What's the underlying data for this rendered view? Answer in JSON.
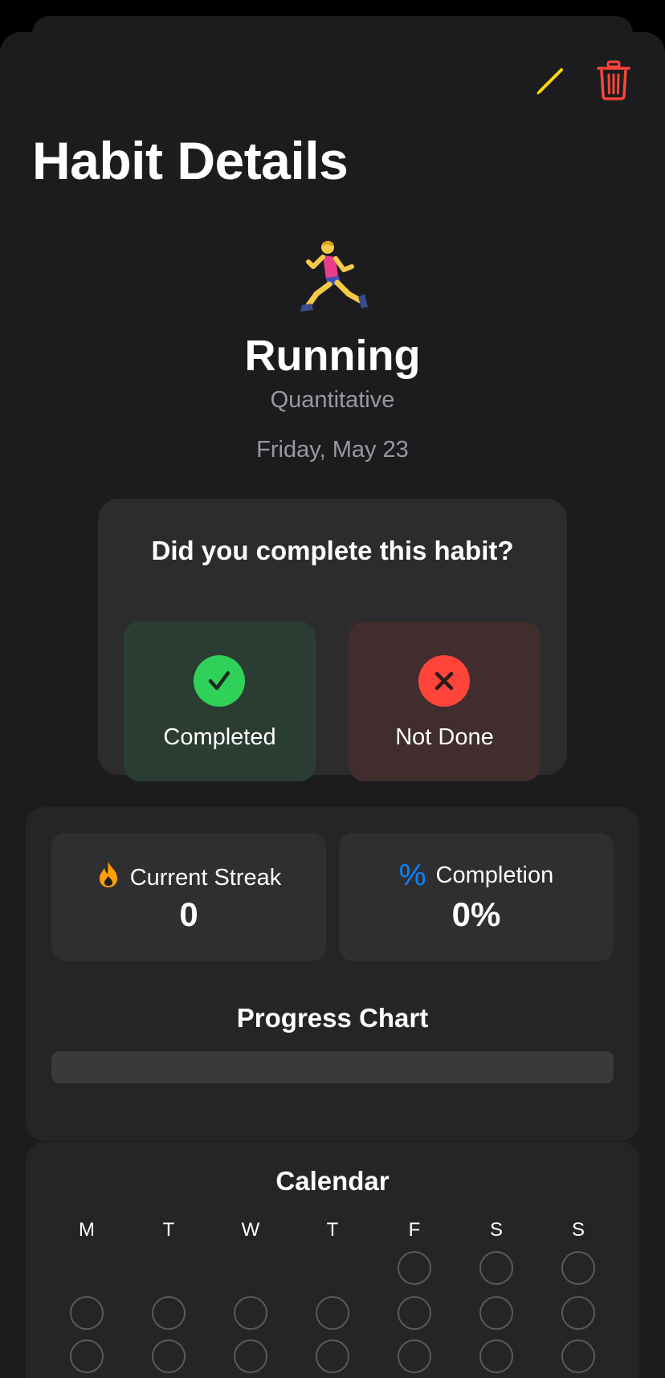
{
  "header": {
    "title": "Habit Details",
    "edit_icon": "pencil-icon",
    "delete_icon": "trash-icon",
    "edit_color": "#ffd60a",
    "delete_color": "#ff453a"
  },
  "habit": {
    "emoji": "running-person-emoji",
    "name": "Running",
    "type": "Quantitative",
    "date": "Friday, May 23"
  },
  "question": {
    "text": "Did you complete this habit?",
    "completed_label": "Completed",
    "not_done_label": "Not Done",
    "completed_color": "#30d158",
    "not_done_color": "#ff453a"
  },
  "stats": {
    "streak_icon": "flame-icon",
    "streak_label": "Current Streak",
    "streak_value": "0",
    "completion_icon": "percent-icon",
    "completion_glyph": "%",
    "completion_label": "Completion",
    "completion_value": "0%",
    "completion_fraction": 0
  },
  "chart": {
    "title": "Progress Chart"
  },
  "calendar": {
    "title": "Calendar",
    "weekdays": [
      "M",
      "T",
      "W",
      "T",
      "F",
      "S",
      "S"
    ],
    "first_weekday_index": 4,
    "visible_day_slots": 17
  }
}
